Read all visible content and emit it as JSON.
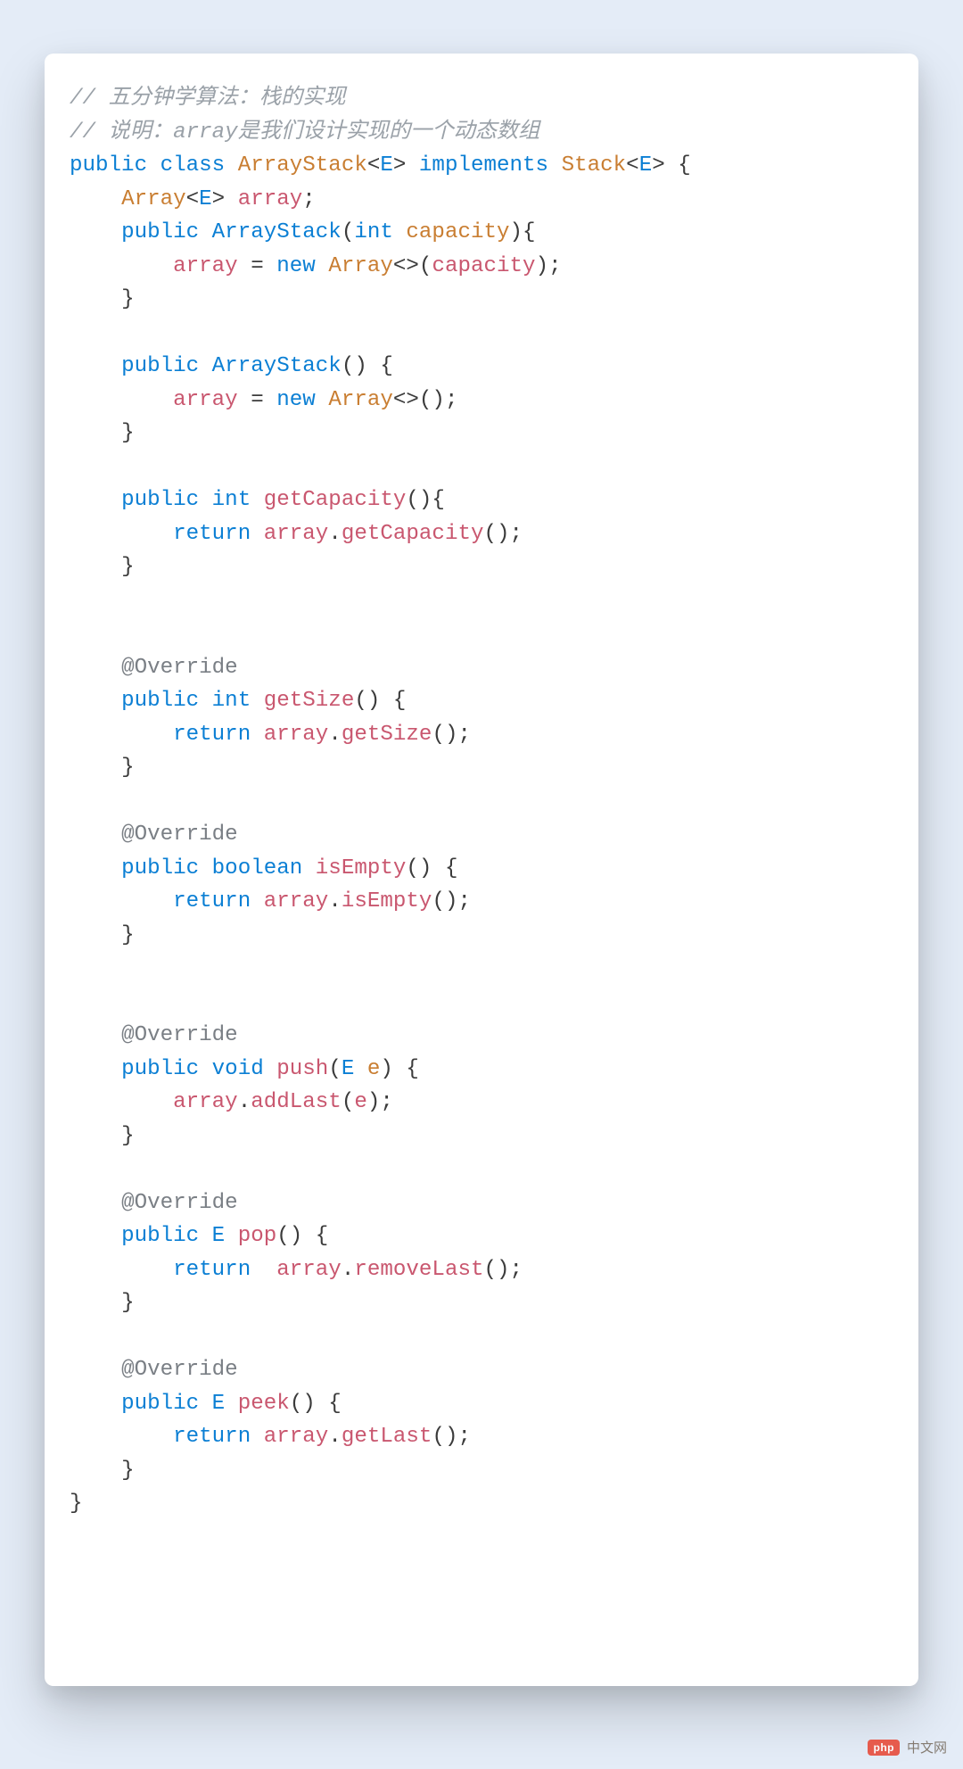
{
  "code": {
    "comment1": "// 五分钟学算法：栈的实现",
    "comment2": "// 说明：array是我们设计实现的一个动态数组",
    "anno_override": "@Override",
    "kw": {
      "public": "public",
      "class": "class",
      "implements": "implements",
      "int": "int",
      "boolean": "boolean",
      "void": "void",
      "return": "return",
      "new": "new"
    },
    "types": {
      "ArrayStack": "ArrayStack",
      "Stack": "Stack",
      "Array": "Array",
      "E": "E"
    },
    "methods": {
      "getCapacity": "getCapacity",
      "getSize": "getSize",
      "isEmpty": "isEmpty",
      "push": "push",
      "pop": "pop",
      "peek": "peek",
      "addLast": "addLast",
      "removeLast": "removeLast",
      "getLast": "getLast"
    },
    "vars": {
      "array": "array",
      "capacity": "capacity",
      "e": "e"
    }
  },
  "watermark": {
    "badge": "php",
    "text": "中文网"
  }
}
